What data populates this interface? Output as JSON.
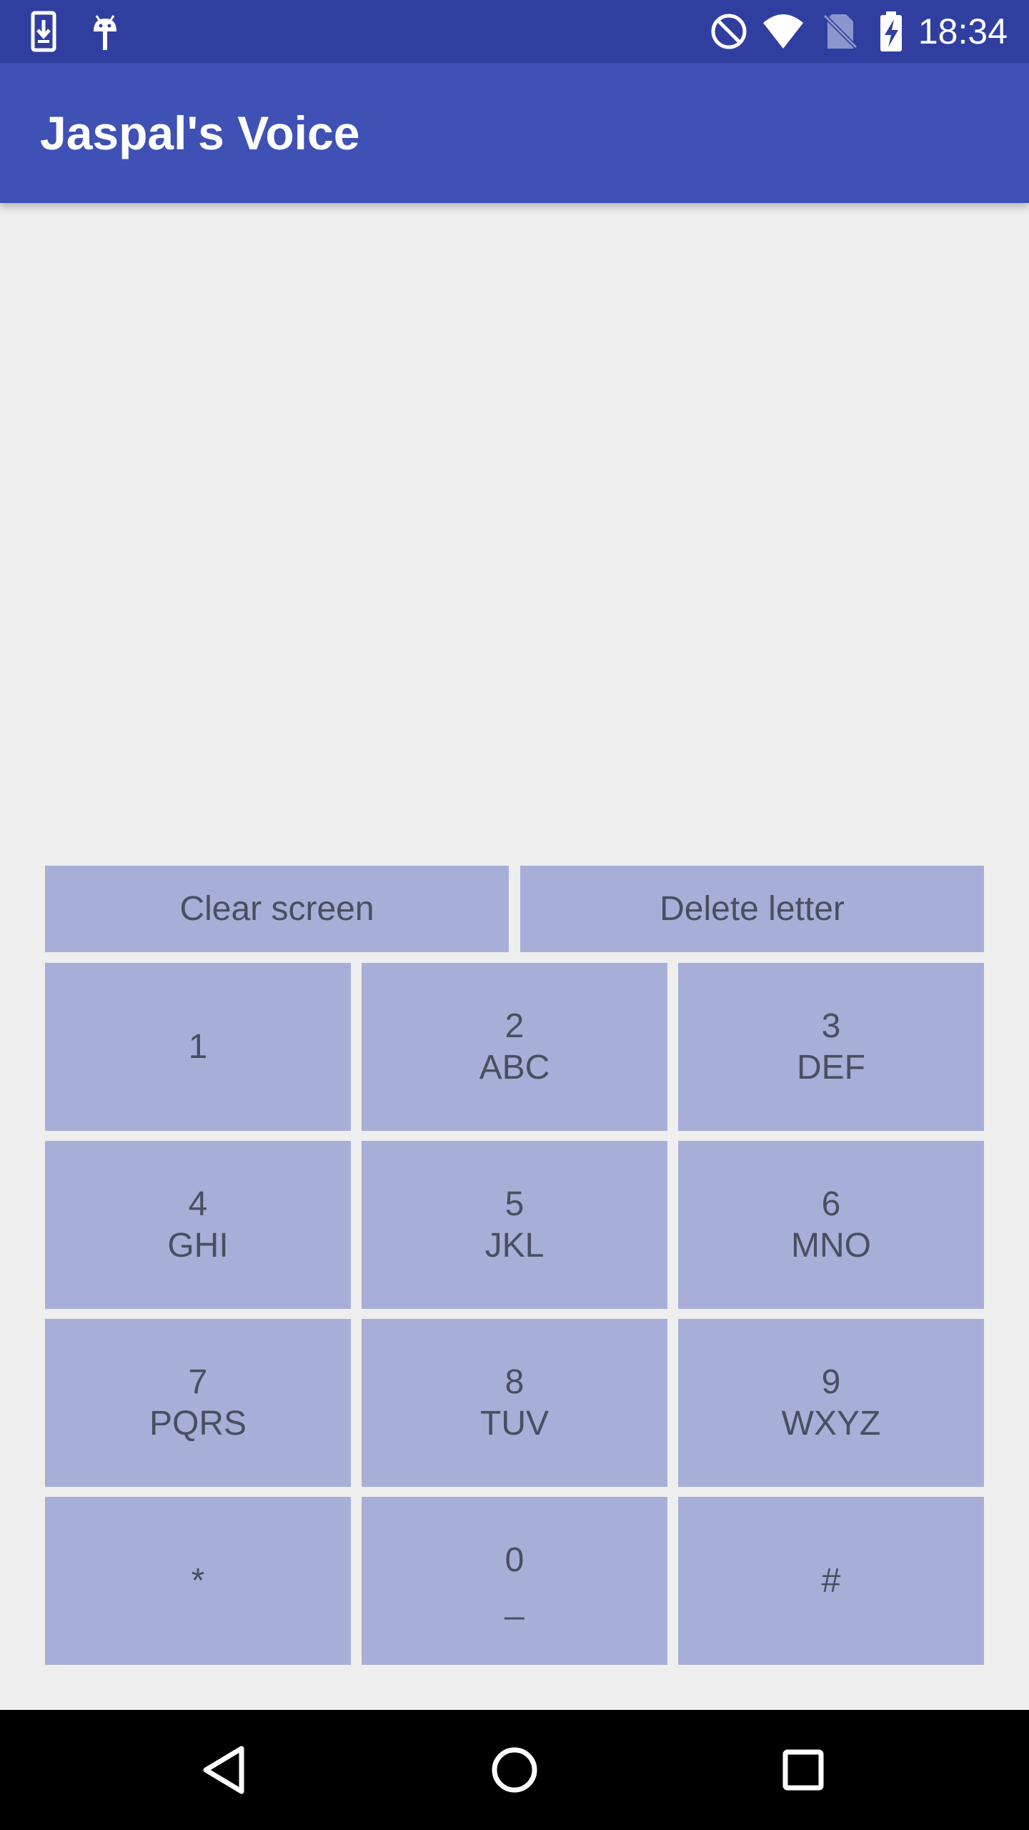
{
  "status_bar": {
    "time": "18:34",
    "icons": [
      "download-icon",
      "android-debug-icon",
      "do-not-disturb-icon",
      "wifi-icon",
      "no-sim-icon",
      "battery-charging-icon"
    ]
  },
  "app_bar": {
    "title": "Jaspal's Voice",
    "background": "#3f51b5"
  },
  "text_display": {
    "value": ""
  },
  "actions": {
    "clear_label": "Clear screen",
    "delete_label": "Delete letter"
  },
  "keys": [
    {
      "digit": "1",
      "letters": ""
    },
    {
      "digit": "2",
      "letters": "ABC"
    },
    {
      "digit": "3",
      "letters": "DEF"
    },
    {
      "digit": "4",
      "letters": "GHI"
    },
    {
      "digit": "5",
      "letters": "JKL"
    },
    {
      "digit": "6",
      "letters": "MNO"
    },
    {
      "digit": "7",
      "letters": "PQRS"
    },
    {
      "digit": "8",
      "letters": "TUV"
    },
    {
      "digit": "9",
      "letters": "WXYZ"
    },
    {
      "digit": "*",
      "letters": ""
    },
    {
      "digit": "0",
      "letters": "_"
    },
    {
      "digit": "#",
      "letters": ""
    }
  ],
  "nav_bar": {
    "icons": [
      "back-icon",
      "home-icon",
      "recents-icon"
    ]
  },
  "colors": {
    "status_bar": "#303f9f",
    "key_background": "#a7afd8",
    "screen_background": "#eeeeee"
  }
}
